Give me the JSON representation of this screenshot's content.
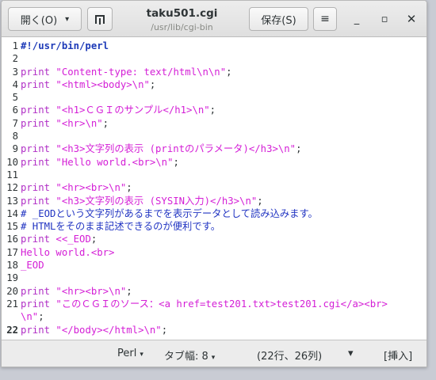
{
  "window": {
    "title": "taku501.cgi",
    "subtitle": "/usr/lib/cgi-bin"
  },
  "headerbar": {
    "open_label": "開く(O)",
    "open_caret": "▾",
    "save_label": "保存(S)",
    "menu_icon": "hamburger-menu-icon",
    "min_glyph": "_",
    "max_glyph": "▫",
    "close_glyph": "✕"
  },
  "editor": {
    "current_line": 22,
    "lines": [
      {
        "n": "1",
        "segs": [
          {
            "t": "#!/usr/bin/perl",
            "c": "shebang"
          }
        ]
      },
      {
        "n": "2",
        "segs": []
      },
      {
        "n": "3",
        "segs": [
          {
            "t": "print ",
            "c": "kw"
          },
          {
            "t": "\"Content-type: text/html\\n\\n\"",
            "c": "str"
          },
          {
            "t": ";",
            "c": "plain"
          }
        ]
      },
      {
        "n": "4",
        "segs": [
          {
            "t": "print ",
            "c": "kw"
          },
          {
            "t": "\"<html><body>\\n\"",
            "c": "str"
          },
          {
            "t": ";",
            "c": "plain"
          }
        ]
      },
      {
        "n": "5",
        "segs": []
      },
      {
        "n": "6",
        "segs": [
          {
            "t": "print ",
            "c": "kw"
          },
          {
            "t": "\"<h1>ＣＧＩのサンプル</h1>\\n\"",
            "c": "str"
          },
          {
            "t": ";",
            "c": "plain"
          }
        ]
      },
      {
        "n": "7",
        "segs": [
          {
            "t": "print ",
            "c": "kw"
          },
          {
            "t": "\"<hr>\\n\"",
            "c": "str"
          },
          {
            "t": ";",
            "c": "plain"
          }
        ]
      },
      {
        "n": "8",
        "segs": []
      },
      {
        "n": "9",
        "segs": [
          {
            "t": "print ",
            "c": "kw"
          },
          {
            "t": "\"<h3>文字列の表示 (printのパラメータ)</h3>\\n\"",
            "c": "str"
          },
          {
            "t": ";",
            "c": "plain"
          }
        ]
      },
      {
        "n": "10",
        "segs": [
          {
            "t": "print ",
            "c": "kw"
          },
          {
            "t": "\"Hello world.<br>\\n\"",
            "c": "str"
          },
          {
            "t": ";",
            "c": "plain"
          }
        ]
      },
      {
        "n": "11",
        "segs": []
      },
      {
        "n": "12",
        "segs": [
          {
            "t": "print ",
            "c": "kw"
          },
          {
            "t": "\"<hr><br>\\n\"",
            "c": "str"
          },
          {
            "t": ";",
            "c": "plain"
          }
        ]
      },
      {
        "n": "13",
        "segs": [
          {
            "t": "print ",
            "c": "kw"
          },
          {
            "t": "\"<h3>文字列の表示 (SYSIN入力)</h3>\\n\"",
            "c": "str"
          },
          {
            "t": ";",
            "c": "plain"
          }
        ]
      },
      {
        "n": "14",
        "segs": [
          {
            "t": "# _EODという文字列があるまでを表示データとして読み込みます。",
            "c": "cmt"
          }
        ]
      },
      {
        "n": "15",
        "segs": [
          {
            "t": "# HTMLをそのまま記述できるのが便利です。",
            "c": "cmt"
          }
        ]
      },
      {
        "n": "16",
        "segs": [
          {
            "t": "print ",
            "c": "kw"
          },
          {
            "t": "<<_EOD",
            "c": "str"
          },
          {
            "t": ";",
            "c": "plain"
          }
        ]
      },
      {
        "n": "17",
        "segs": [
          {
            "t": "Hello world.<br>",
            "c": "str"
          }
        ]
      },
      {
        "n": "18",
        "segs": [
          {
            "t": "_EOD",
            "c": "str"
          }
        ]
      },
      {
        "n": "19",
        "segs": []
      },
      {
        "n": "20",
        "segs": [
          {
            "t": "print ",
            "c": "kw"
          },
          {
            "t": "\"<hr><br>\\n\"",
            "c": "str"
          },
          {
            "t": ";",
            "c": "plain"
          }
        ]
      },
      {
        "n": "21",
        "segs": [
          {
            "t": "print ",
            "c": "kw"
          },
          {
            "t": "\"このＣＧＩのソース：<a href=test201.txt>test201.cgi</a><br>",
            "c": "str"
          }
        ]
      },
      {
        "n": "",
        "segs": [
          {
            "t": "\\n\"",
            "c": "str"
          },
          {
            "t": ";",
            "c": "plain"
          }
        ]
      },
      {
        "n": "22",
        "segs": [
          {
            "t": "print ",
            "c": "kw"
          },
          {
            "t": "\"</body></html>\\n\"",
            "c": "str"
          },
          {
            "t": ";",
            "c": "plain"
          }
        ]
      }
    ]
  },
  "statusbar": {
    "language": "Perl",
    "tab_width": "タブ幅: 8",
    "position": "(22行、26列)",
    "dropdown": "▾",
    "mode": "[挿入]",
    "caret": "▾"
  }
}
